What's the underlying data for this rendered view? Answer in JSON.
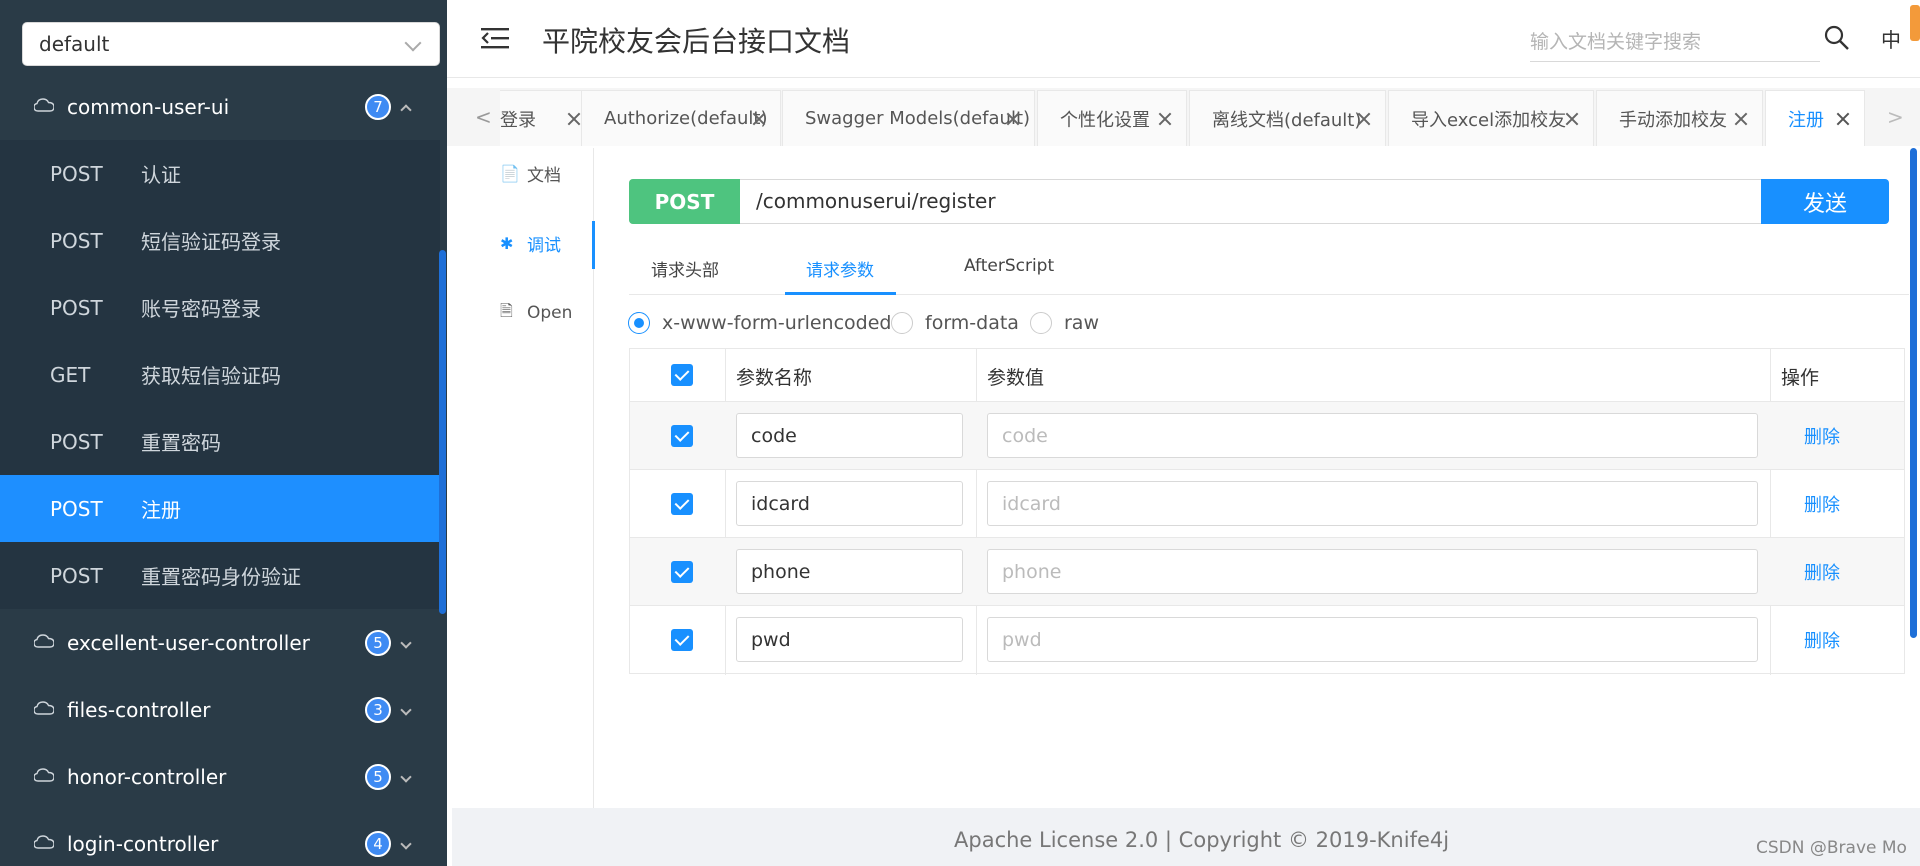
{
  "sidebar": {
    "group_select": "default",
    "groups": [
      {
        "name": "common-user-ui",
        "count": "7"
      },
      {
        "name": "excellent-user-controller",
        "count": "5"
      },
      {
        "name": "files-controller",
        "count": "3"
      },
      {
        "name": "honor-controller",
        "count": "5"
      },
      {
        "name": "login-controller",
        "count": "4"
      }
    ],
    "apis": [
      {
        "method": "POST",
        "title": "认证"
      },
      {
        "method": "POST",
        "title": "短信验证码登录"
      },
      {
        "method": "POST",
        "title": "账号密码登录"
      },
      {
        "method": "GET",
        "title": "获取短信验证码"
      },
      {
        "method": "POST",
        "title": "重置密码"
      },
      {
        "method": "POST",
        "title": "注册"
      },
      {
        "method": "POST",
        "title": "重置密码身份验证"
      }
    ]
  },
  "header": {
    "title": "平院校友会后台接口文档",
    "search_placeholder": "输入文档关键字搜索",
    "lang": "中"
  },
  "tabs": [
    {
      "label": "登录"
    },
    {
      "label": "Authorize(default)"
    },
    {
      "label": "Swagger Models(default)"
    },
    {
      "label": "个性化设置"
    },
    {
      "label": "离线文档(default)"
    },
    {
      "label": "导入excel添加校友"
    },
    {
      "label": "手动添加校友"
    },
    {
      "label": "注册"
    }
  ],
  "sidenav": [
    {
      "icon": "document-icon",
      "label": "文档"
    },
    {
      "icon": "bug-icon",
      "label": "调试"
    },
    {
      "icon": "file-icon",
      "label": "Open"
    }
  ],
  "request": {
    "method": "POST",
    "url": "/commonuserui/register",
    "send": "发送"
  },
  "subtabs": [
    "请求头部",
    "请求参数",
    "AfterScript"
  ],
  "radios": [
    "x-www-form-urlencoded",
    "form-data",
    "raw"
  ],
  "table": {
    "headers": {
      "name": "参数名称",
      "value": "参数值",
      "op": "操作"
    },
    "rows": [
      {
        "name": "code",
        "placeholder": "code",
        "op": "删除"
      },
      {
        "name": "idcard",
        "placeholder": "idcard",
        "op": "删除"
      },
      {
        "name": "phone",
        "placeholder": "phone",
        "op": "删除"
      },
      {
        "name": "pwd",
        "placeholder": "pwd",
        "op": "删除"
      }
    ]
  },
  "footer": {
    "text": "Apache License 2.0 | Copyright © 2019-Knife4j",
    "watermark": "CSDN @Brave Mo"
  }
}
